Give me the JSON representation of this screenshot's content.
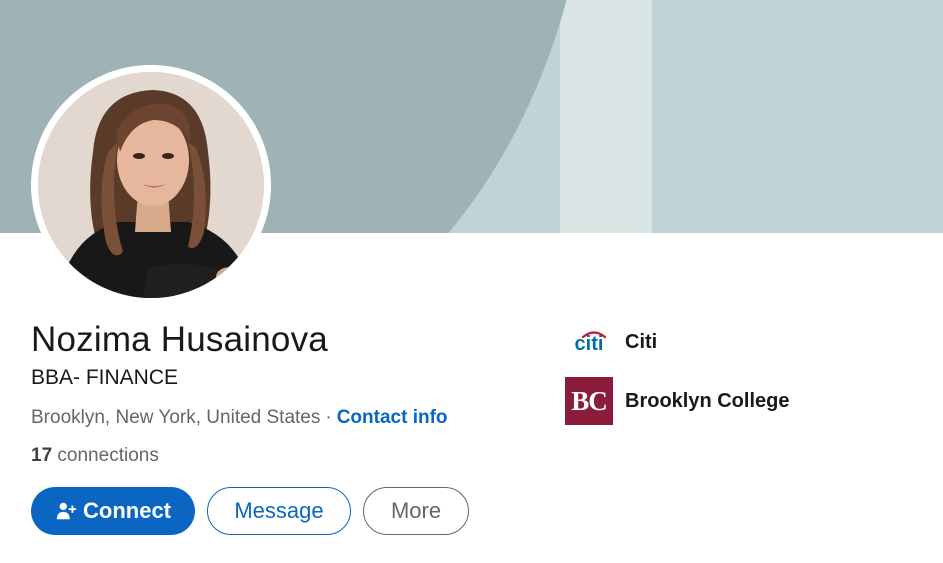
{
  "profile": {
    "name": "Nozima Husainova",
    "headline": "BBA- FINANCE",
    "location": "Brooklyn, New York, United States",
    "separator": "·",
    "contact_info_label": "Contact info",
    "connections_count": "17",
    "connections_label": "connections"
  },
  "actions": {
    "connect_label": "Connect",
    "message_label": "Message",
    "more_label": "More"
  },
  "organizations": {
    "experience": {
      "name": "Citi",
      "logo_text": "citi",
      "logo_icon": "citi-logo"
    },
    "education": {
      "name": "Brooklyn College",
      "logo_text": "BC",
      "logo_icon": "brooklyn-college-logo"
    }
  },
  "colors": {
    "accent": "#0a66c2",
    "banner_dark": "#9fb2b5",
    "banner_light": "#c0d4d6",
    "brooklyn_college": "#8a1c3c",
    "citi_blue": "#056dae",
    "citi_red": "#d30f2d"
  },
  "icons": {
    "connect": "add-person-icon"
  }
}
